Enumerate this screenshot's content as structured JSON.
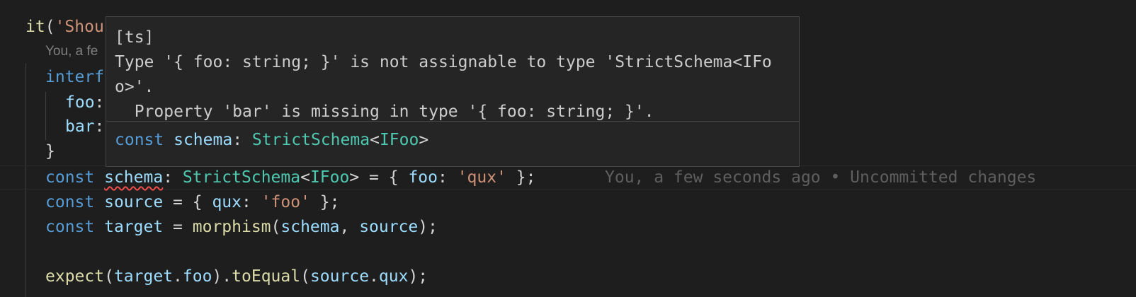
{
  "editor": {
    "line1": {
      "fn": "it",
      "paren": "(",
      "str": "'Shou"
    },
    "blame_top": "You, a fe",
    "line_interface": {
      "kw": "interf"
    },
    "line_foo": {
      "name": "foo",
      "colon": ":"
    },
    "line_bar": {
      "name": "bar",
      "colon": ":"
    },
    "line_close": "}",
    "line_schema": {
      "kw": "const",
      "name": "schema",
      "colon": ":",
      "type": "StrictSchema",
      "lt": "<",
      "generic": "IFoo",
      "gt_eq_open": "> = { ",
      "prop": "foo",
      "prop_colon": ": ",
      "val": "'qux'",
      "close": " };",
      "blame": "You, a few seconds ago • Uncommitted changes"
    },
    "line_source": {
      "kw": "const",
      "name": "source",
      "eq_open": " = { ",
      "prop": "qux",
      "prop_colon": ": ",
      "val": "'foo'",
      "close": " };"
    },
    "line_target": {
      "kw": "const",
      "name": "target",
      "eq": " = ",
      "fn": "morphism",
      "open": "(",
      "arg1": "schema",
      "comma": ", ",
      "arg2": "source",
      "close": ");"
    },
    "line_expect": {
      "fn": "expect",
      "open": "(",
      "obj": "target",
      "dot": ".",
      "prop": "foo",
      "close_dot": ").",
      "method": "toEqual",
      "open2": "(",
      "obj2": "source",
      "dot2": ".",
      "prop2": "qux",
      "close": ");"
    }
  },
  "hover": {
    "source": "[ts]",
    "message_line1": "Type '{ foo: string; }' is not assignable to type 'StrictSchema<IFo",
    "message_line2": "o>'.",
    "message_line3": "  Property 'bar' is missing in type '{ foo: string; }'.",
    "signature": {
      "kw": "const",
      "name": "schema",
      "colon": ": ",
      "type": "StrictSchema",
      "lt": "<",
      "generic": "IFoo",
      "gt": ">"
    }
  },
  "colors": {
    "background": "#1e1e1e",
    "keyword": "#569cd6",
    "variable": "#9cdcfe",
    "type": "#4ec9b0",
    "string": "#ce9178",
    "function": "#dcdcaa",
    "error": "#f14c4c"
  }
}
